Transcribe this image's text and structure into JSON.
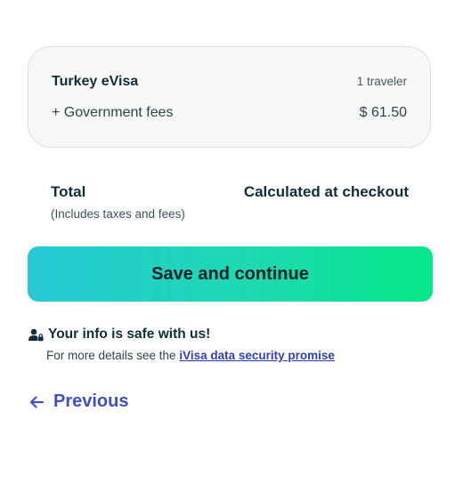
{
  "summary": {
    "product_name": "Turkey eVisa",
    "traveler_count": "1 traveler",
    "fees_label": "+ Government fees",
    "fees_amount": "$ 61.50"
  },
  "total": {
    "label": "Total",
    "value": "Calculated at checkout",
    "note": "(Includes taxes and fees)"
  },
  "actions": {
    "continue_label": "Save and continue",
    "previous_label": "Previous"
  },
  "security": {
    "title": "Your info is safe with us!",
    "details_prefix": "For more details see the ",
    "link_text": "iVisa data security promise"
  },
  "colors": {
    "cta_gradient_start": "#27c9d6",
    "cta_gradient_end": "#06e88a",
    "link": "#2f3fb5",
    "previous": "#3f4fc7",
    "text_dark": "#0f2e3b"
  },
  "icons": {
    "security": "user-lock-icon",
    "previous": "arrow-left-icon"
  }
}
